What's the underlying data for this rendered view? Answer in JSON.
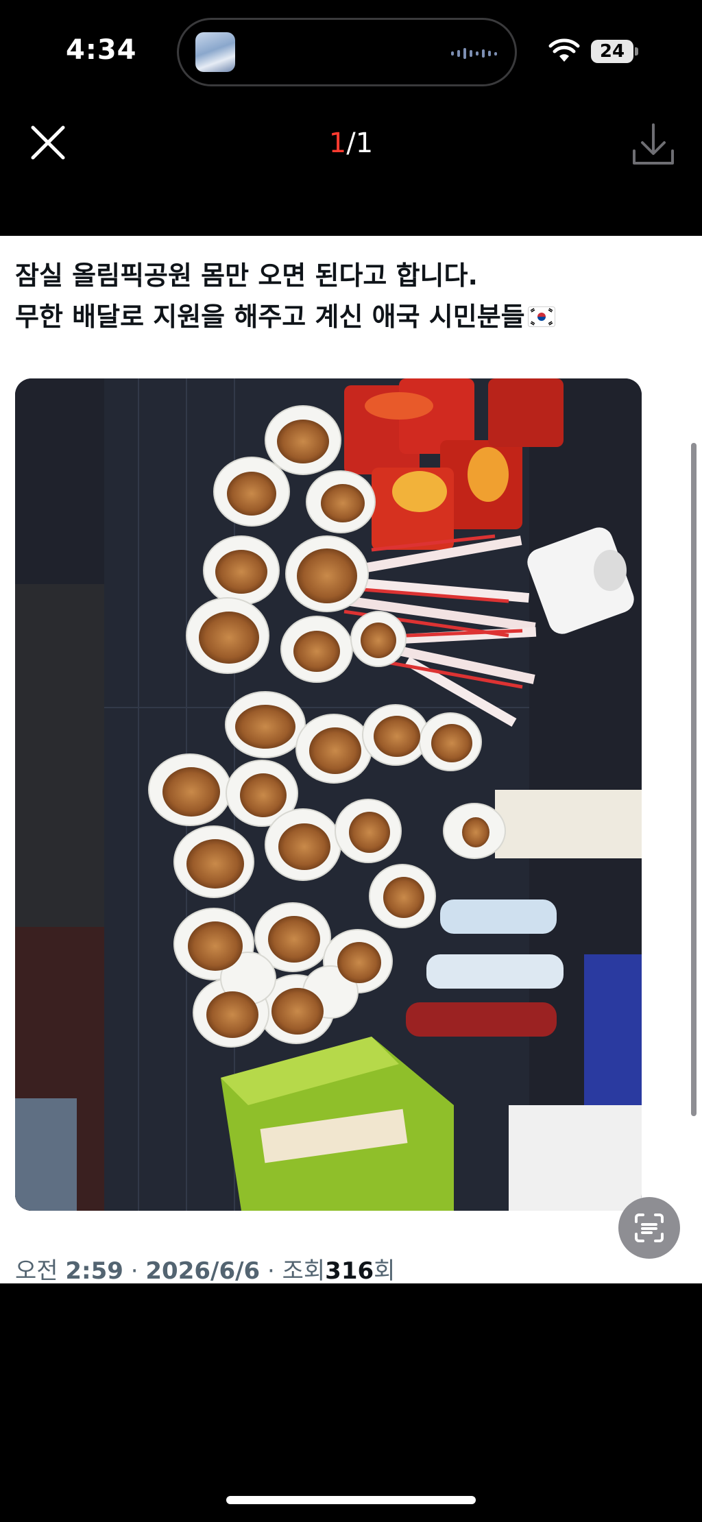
{
  "status_bar": {
    "time": "4:34",
    "battery": "24",
    "wifi_icon": "wifi-icon"
  },
  "header": {
    "counter_current": "1",
    "counter_total": "/1",
    "close_icon": "close-icon",
    "download_icon": "download-icon"
  },
  "post": {
    "line1": "잠실 올림픽공원 몸만 오면 된다고 합니다.",
    "line2": "무한 배달로 지원을 해주고 계신 애국 시민분들",
    "flag_icon": "south-korea-flag-icon",
    "image_icon": "photo-image",
    "meta": {
      "ampm": "오전",
      "time": "2:59",
      "sep1": "·",
      "date": "2026/6/6",
      "sep2": "·",
      "views_label": "조회",
      "views_count": "316",
      "views_unit": "회"
    }
  },
  "colors": {
    "counter_accent": "#ff3b30",
    "text_primary": "#0f1419",
    "text_secondary": "#536471"
  }
}
